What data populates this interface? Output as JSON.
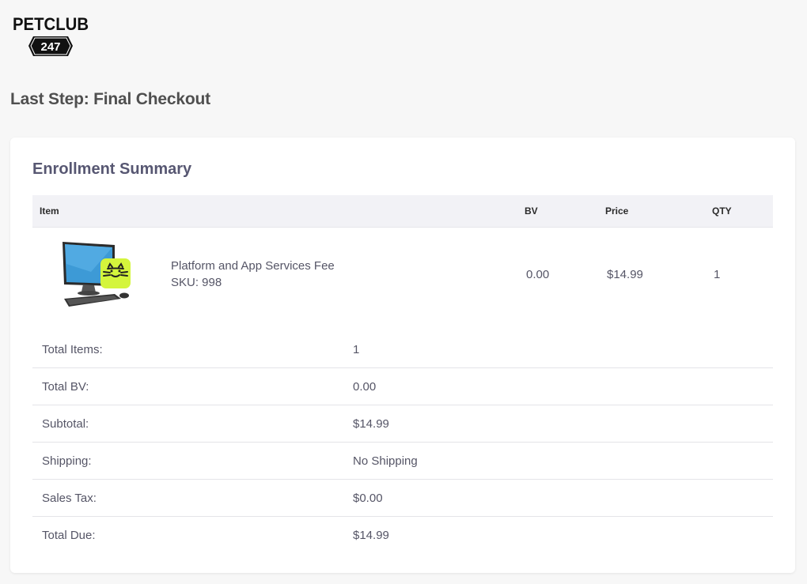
{
  "brand": {
    "logo_top": "PETCLUB",
    "logo_bottom": "247"
  },
  "page": {
    "title": "Last Step: Final Checkout"
  },
  "summary": {
    "title": "Enrollment Summary",
    "columns": {
      "item": "Item",
      "bv": "BV",
      "price": "Price",
      "qty": "QTY"
    },
    "items": [
      {
        "name": "Platform and App Services Fee",
        "sku": "SKU: 998",
        "bv": "0.00",
        "price": "$14.99",
        "qty": "1",
        "icon": "computer-with-cat-app-icon"
      }
    ],
    "totals": [
      {
        "label": "Total Items:",
        "value": "1"
      },
      {
        "label": "Total BV:",
        "value": "0.00"
      },
      {
        "label": "Subtotal:",
        "value": "$14.99"
      },
      {
        "label": "Shipping:",
        "value": "No Shipping"
      },
      {
        "label": "Sales Tax:",
        "value": "$0.00"
      },
      {
        "label": "Total Due:",
        "value": "$14.99"
      }
    ]
  },
  "colors": {
    "background": "#f7f7f7",
    "card": "#ffffff",
    "header_row": "#f2f2f6",
    "text": "#555566",
    "app_badge": "#d4f53c"
  }
}
